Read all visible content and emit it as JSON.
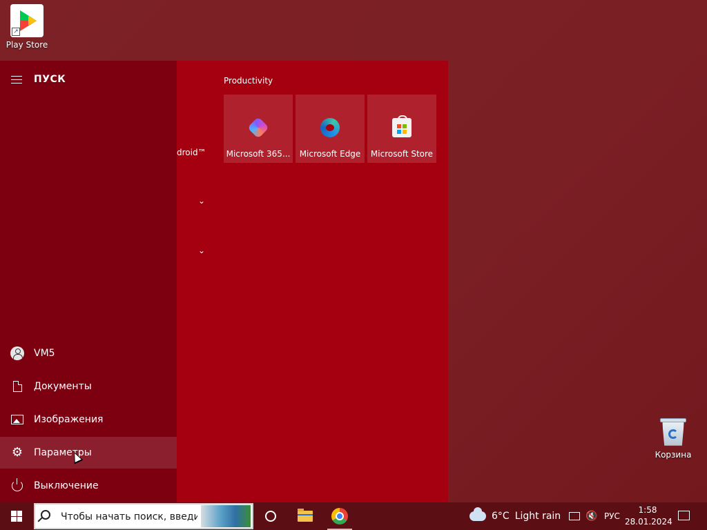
{
  "desktop": {
    "icons": [
      {
        "label": "Play Store",
        "icon": "play-store-icon"
      },
      {
        "label": "Корзина",
        "icon": "recycle-bin-icon"
      }
    ]
  },
  "start_menu": {
    "title": "ПУСК",
    "hamburger_icon": "hamburger-menu-icon",
    "sidebar": {
      "items": [
        {
          "label": "VM5",
          "icon": "user-avatar-icon"
        },
        {
          "label": "Документы",
          "icon": "document-icon"
        },
        {
          "label": "Изображения",
          "icon": "pictures-icon"
        },
        {
          "label": "Параметры",
          "icon": "gear-icon",
          "hovered": true
        },
        {
          "label": "Выключение",
          "icon": "power-icon"
        }
      ]
    },
    "app_list": {
      "partial_text": "droid™",
      "expand_chevrons": [
        "chevron-down-icon",
        "chevron-down-icon"
      ]
    },
    "tiles": {
      "group_label": "Productivity",
      "items": [
        {
          "label": "Microsoft 365...",
          "icon": "microsoft-365-icon"
        },
        {
          "label": "Microsoft Edge",
          "icon": "edge-icon"
        },
        {
          "label": "Microsoft Store",
          "icon": "store-icon"
        }
      ]
    }
  },
  "taskbar": {
    "search_placeholder": "Чтобы начать поиск, введи",
    "apps": [
      {
        "name": "Cortana",
        "icon": "cortana-icon"
      },
      {
        "name": "File Explorer",
        "icon": "folder-icon"
      },
      {
        "name": "Google Chrome",
        "icon": "chrome-icon"
      }
    ],
    "weather": {
      "temperature": "6°C",
      "condition": "Light rain"
    },
    "language": "РУС",
    "time": "1:58",
    "date": "28.01.2024"
  },
  "colors": {
    "accent": "#a5000f",
    "sidebar": "#7d0010",
    "desktop": "#7a1f24",
    "taskbar": "#5b0f15"
  }
}
